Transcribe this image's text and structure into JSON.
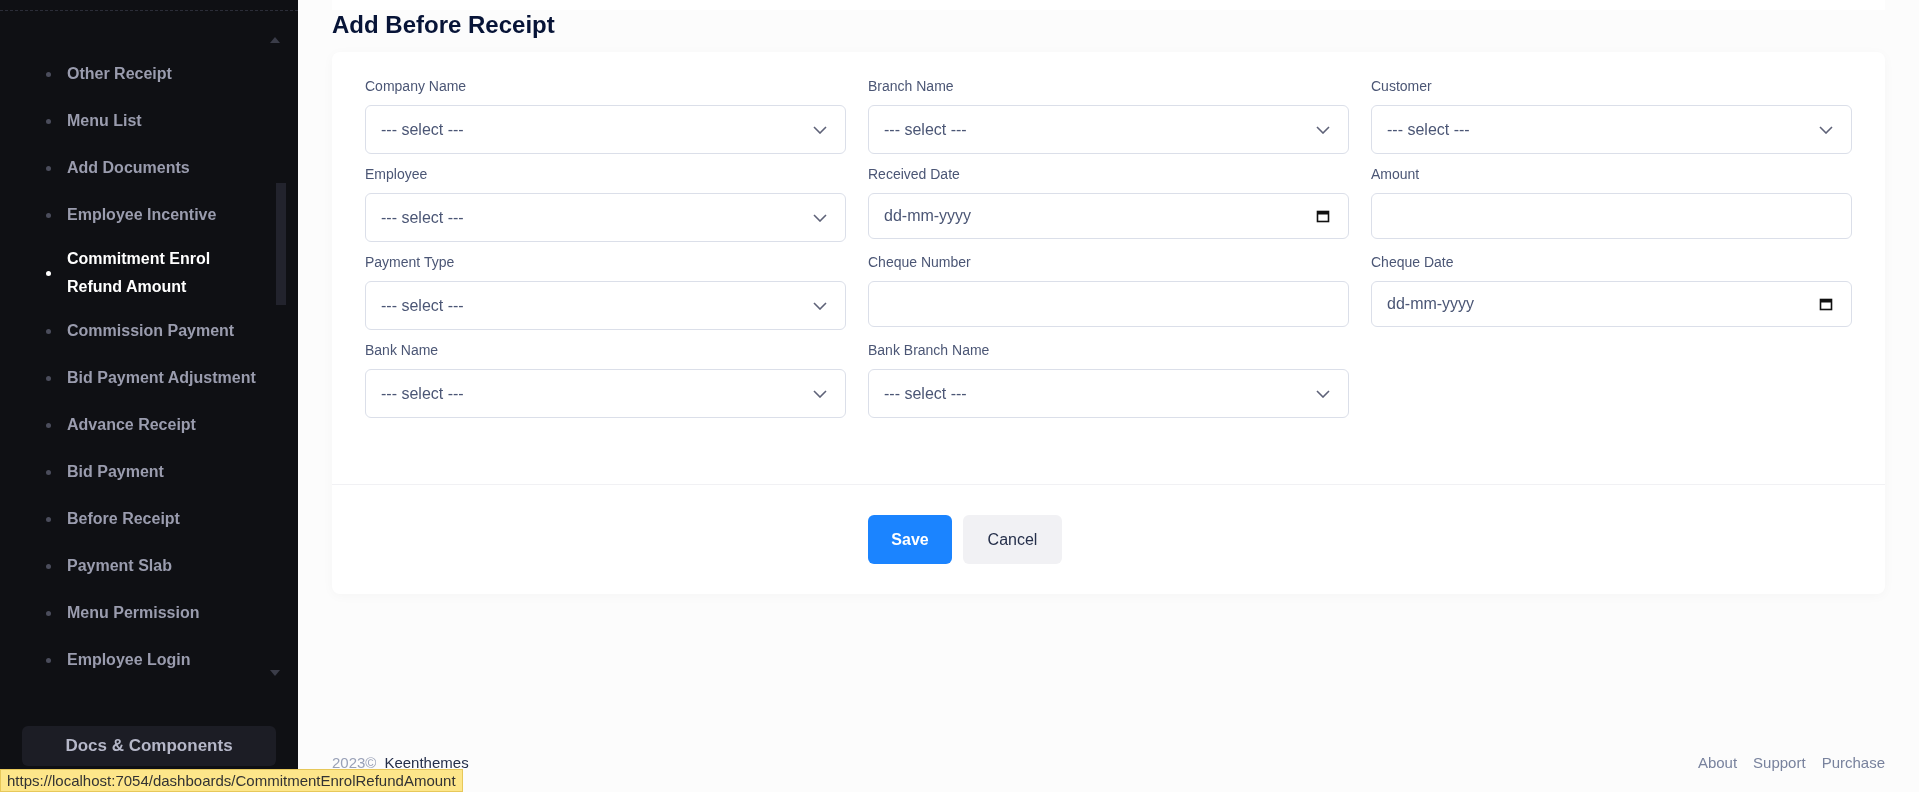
{
  "sidebar": {
    "items": [
      {
        "label": "Other Receipt",
        "selected": false
      },
      {
        "label": "Menu List",
        "selected": false
      },
      {
        "label": "Add Documents",
        "selected": false
      },
      {
        "label": "Employee Incentive",
        "selected": false
      },
      {
        "label": "Commitment Enrol Refund Amount",
        "selected": true
      },
      {
        "label": "Commission Payment",
        "selected": false
      },
      {
        "label": "Bid Payment Adjustment",
        "selected": false
      },
      {
        "label": "Advance Receipt",
        "selected": false
      },
      {
        "label": "Bid Payment",
        "selected": false
      },
      {
        "label": "Before Receipt",
        "selected": false
      },
      {
        "label": "Payment Slab",
        "selected": false
      },
      {
        "label": "Menu Permission",
        "selected": false
      },
      {
        "label": "Employee Login",
        "selected": false
      }
    ],
    "docs_button": "Docs & Components"
  },
  "page_title": "Add Before Receipt",
  "form": {
    "fields": [
      {
        "label": "Company Name",
        "kind": "select",
        "value": "--- select ---"
      },
      {
        "label": "Branch Name",
        "kind": "select",
        "value": "--- select ---"
      },
      {
        "label": "Customer",
        "kind": "select",
        "value": "--- select ---"
      },
      {
        "label": "Employee",
        "kind": "select",
        "value": "--- select ---"
      },
      {
        "label": "Received Date",
        "kind": "date",
        "placeholder": "dd-mm-yyyy"
      },
      {
        "label": "Amount",
        "kind": "text"
      },
      {
        "label": "Payment Type",
        "kind": "select",
        "value": "--- select ---"
      },
      {
        "label": "Cheque Number",
        "kind": "text"
      },
      {
        "label": "Cheque Date",
        "kind": "date",
        "placeholder": "dd-mm-yyyy"
      },
      {
        "label": "Bank Name",
        "kind": "select",
        "value": "--- select ---"
      },
      {
        "label": "Bank Branch Name",
        "kind": "select",
        "value": "--- select ---"
      }
    ],
    "buttons": [
      {
        "label": "Save",
        "kind": "primary"
      },
      {
        "label": "Cancel",
        "kind": "secondary"
      }
    ]
  },
  "footer": {
    "year": "2023©",
    "brand": "Keenthemes",
    "links": [
      "About",
      "Support",
      "Purchase"
    ]
  },
  "status_url": "https://localhost:7054/dashboards/CommitmentEnrolRefundAmount"
}
